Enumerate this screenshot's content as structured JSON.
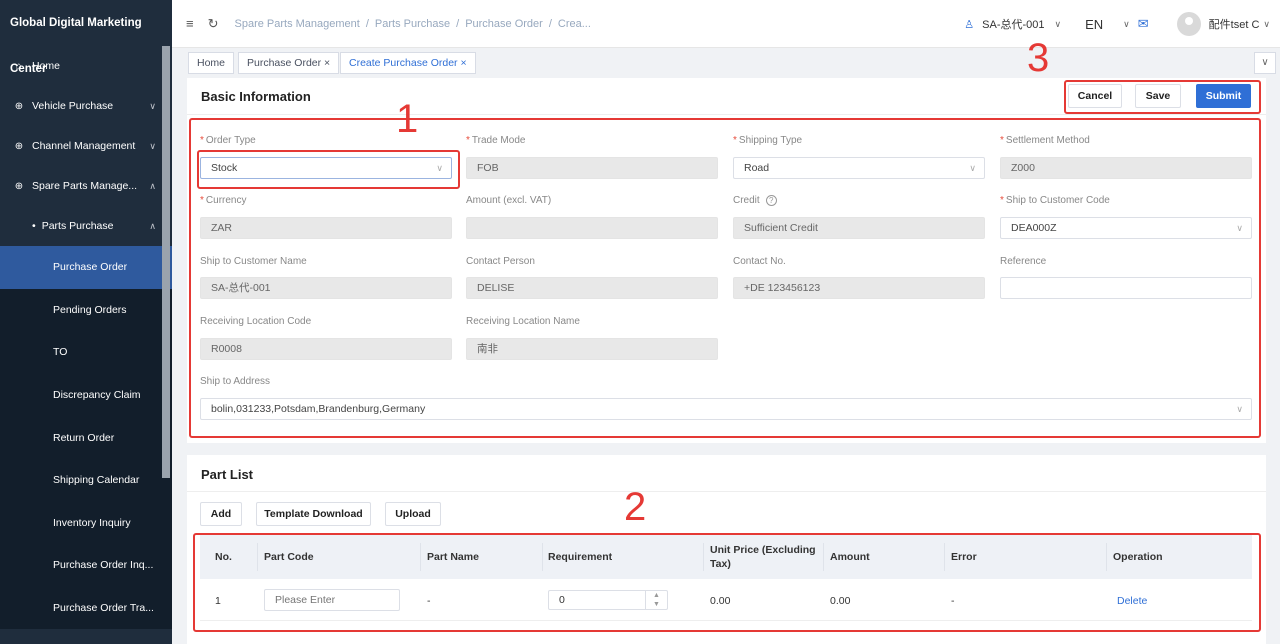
{
  "app": {
    "title": "Global Digital Marketing Center"
  },
  "sidebar": {
    "items": [
      {
        "label": "Home",
        "icon": "home-icon"
      },
      {
        "label": "Vehicle Purchase",
        "icon": "plus-circle-icon"
      },
      {
        "label": "Channel Management",
        "icon": "plus-circle-icon"
      },
      {
        "label": "Spare Parts Manage...",
        "icon": "plus-circle-icon"
      }
    ],
    "group": {
      "label": "Parts Purchase"
    },
    "subitems": [
      "Purchase Order",
      "Pending Orders",
      "TO",
      "Discrepancy Claim",
      "Return Order",
      "Shipping Calendar",
      "Inventory Inquiry",
      "Purchase Order Inq...",
      "Purchase Order Tra..."
    ],
    "active_subitem": "Purchase Order"
  },
  "topbar": {
    "breadcrumb": [
      "Spare Parts Management",
      "Parts Purchase",
      "Purchase Order",
      "Crea..."
    ],
    "dealer": "SA-总代-001",
    "language": "EN",
    "user": "配件tset C"
  },
  "tabs": [
    "Home",
    "Purchase Order",
    "Create Purchase Order"
  ],
  "basic": {
    "title": "Basic Information",
    "buttons": {
      "cancel": "Cancel",
      "save": "Save",
      "submit": "Submit"
    },
    "fields": {
      "order_type": {
        "label": "Order Type",
        "value": "Stock"
      },
      "trade_mode": {
        "label": "Trade Mode",
        "value": "FOB"
      },
      "shipping_type": {
        "label": "Shipping Type",
        "value": "Road"
      },
      "settlement": {
        "label": "Settlement Method",
        "value": "Z000"
      },
      "currency": {
        "label": "Currency",
        "value": "ZAR"
      },
      "amount": {
        "label": "Amount (excl. VAT)",
        "value": ""
      },
      "credit": {
        "label": "Credit",
        "value": "Sufficient Credit"
      },
      "ship_code": {
        "label": "Ship to Customer Code",
        "value": "DEA000Z"
      },
      "ship_name": {
        "label": "Ship to Customer Name",
        "value": "SA-总代-001"
      },
      "contact_person": {
        "label": "Contact Person",
        "value": "DELISE"
      },
      "contact_no": {
        "label": "Contact No.",
        "value": "+DE 123456123"
      },
      "reference": {
        "label": "Reference",
        "value": ""
      },
      "rl_code": {
        "label": "Receiving Location Code",
        "value": "R0008"
      },
      "rl_name": {
        "label": "Receiving Location Name",
        "value": "南非"
      },
      "address": {
        "label": "Ship to Address",
        "value": "bolin,031233,Potsdam,Brandenburg,Germany"
      }
    }
  },
  "parts": {
    "title": "Part List",
    "buttons": {
      "add": "Add",
      "template": "Template Download",
      "upload": "Upload"
    },
    "columns": [
      "No.",
      "Part Code",
      "Part Name",
      "Requirement",
      "Unit Price (Excluding Tax)",
      "Amount",
      "Error",
      "Operation"
    ],
    "rows": [
      {
        "no": "1",
        "part_code_placeholder": "Please Enter",
        "part_name": "-",
        "requirement": "0",
        "unit_price": "0.00",
        "amount": "0.00",
        "error": "-",
        "operation": "Delete"
      }
    ]
  },
  "annotations": [
    "1",
    "2",
    "3"
  ],
  "colors": {
    "sidebar": "#1f2d3d",
    "accent": "#2f6fd6",
    "annotation": "#e53935"
  }
}
